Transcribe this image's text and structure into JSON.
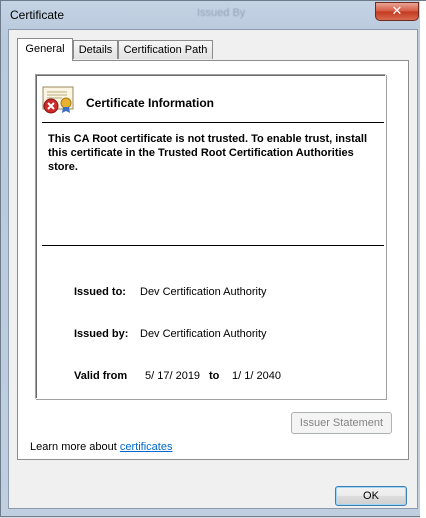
{
  "window": {
    "title": "Certificate",
    "background_title": "Issued By"
  },
  "tabs": [
    {
      "label": "General",
      "active": true
    },
    {
      "label": "Details",
      "active": false
    },
    {
      "label": "Certification Path",
      "active": false
    }
  ],
  "info": {
    "heading": "Certificate Information",
    "warning": "This CA Root certificate is not trusted. To enable trust, install this certificate in the Trusted Root Certification Authorities store."
  },
  "fields": {
    "issued_to_label": "Issued to:",
    "issued_to_value": "Dev Certification Authority",
    "issued_by_label": "Issued by:",
    "issued_by_value": "Dev Certification Authority",
    "valid_from_label": "Valid from",
    "valid_from_value": "5/ 17/ 2019",
    "valid_to_label": "to",
    "valid_to_value": "1/ 1/ 2040"
  },
  "buttons": {
    "issuer_statement": "Issuer Statement",
    "ok": "OK"
  },
  "learn_more": {
    "prefix": "Learn more about ",
    "link": "certificates"
  },
  "icons": {
    "certificate": "certificate-error-icon",
    "close": "close-icon"
  },
  "colors": {
    "link": "#0066cc",
    "close_button": "#c2381f",
    "error_badge": "#cc2a2a"
  }
}
